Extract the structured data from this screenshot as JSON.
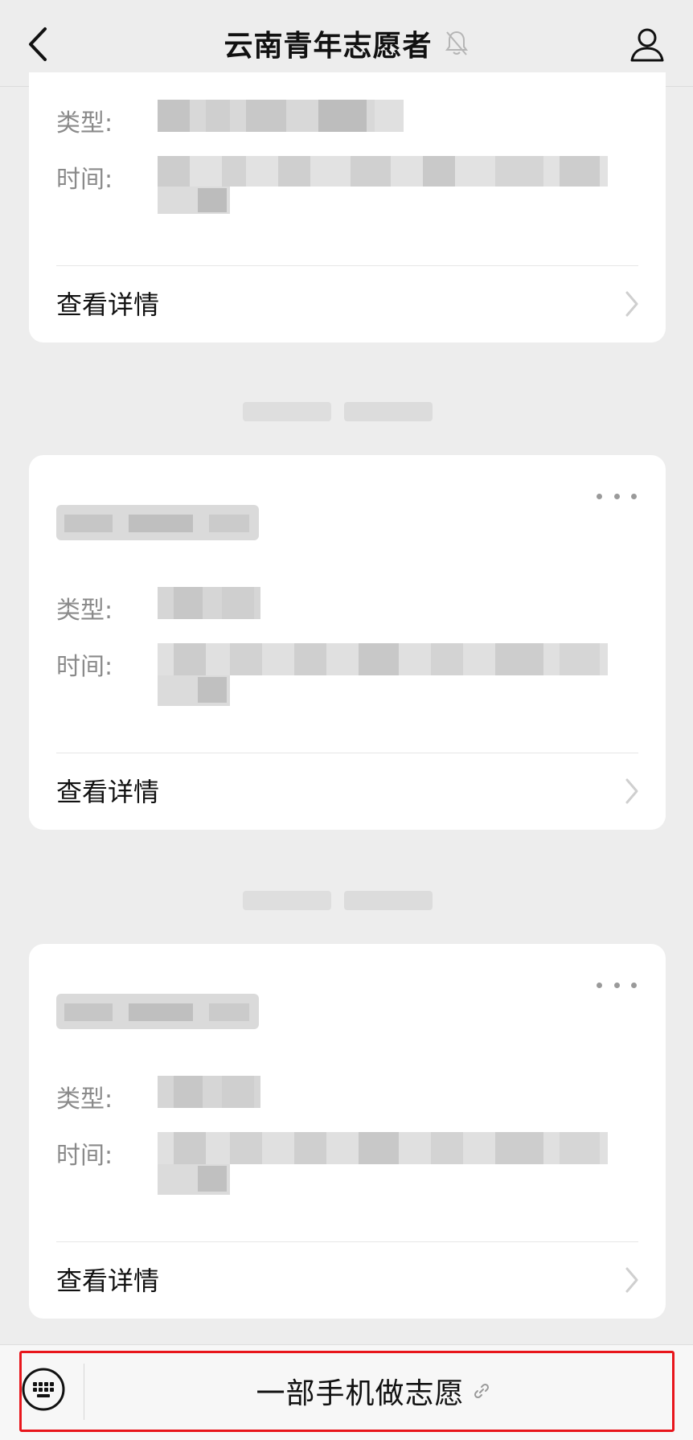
{
  "header": {
    "title": "云南青年志愿者",
    "back_icon": "chevron-left-icon",
    "bell_icon": "bell-muted-icon",
    "profile_icon": "person-icon"
  },
  "cards": [
    {
      "type_label": "类型:",
      "time_label": "时间:",
      "detail_label": "查看详情"
    },
    {
      "type_label": "类型:",
      "time_label": "时间:",
      "detail_label": "查看详情"
    },
    {
      "type_label": "类型:",
      "time_label": "时间:",
      "detail_label": "查看详情"
    }
  ],
  "bottom_menu": {
    "keyboard_icon": "keyboard-icon",
    "item_label": "一部手机做志愿",
    "link_icon": "link-icon"
  },
  "colors": {
    "background": "#ededed",
    "card": "#ffffff",
    "highlight_box": "#e8161c"
  }
}
